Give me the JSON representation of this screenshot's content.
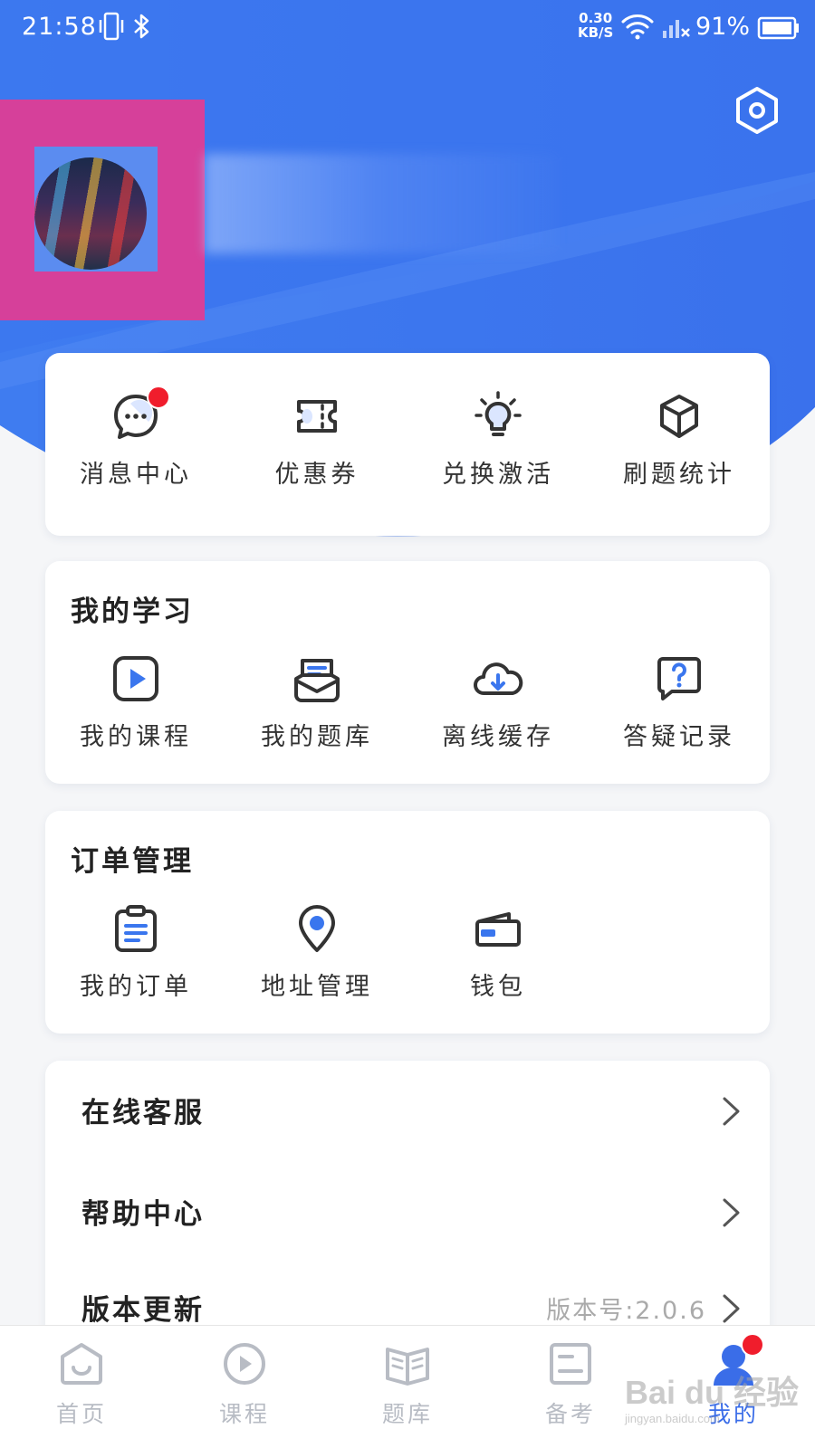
{
  "status_bar": {
    "time": "21:58",
    "net_speed_value": "0.30",
    "net_speed_unit": "KB/S",
    "battery": "91%",
    "icons": [
      "vibrate-icon",
      "bluetooth-icon",
      "wifi-icon",
      "signal-icon",
      "battery-icon"
    ]
  },
  "header": {
    "settings_icon": "settings-hexagon-icon",
    "accent": "#3a76ee"
  },
  "quick_actions": [
    {
      "label": "消息中心",
      "icon": "message-bubble-icon",
      "badge": true
    },
    {
      "label": "优惠券",
      "icon": "ticket-icon",
      "badge": false
    },
    {
      "label": "兑换激活",
      "icon": "lightbulb-icon",
      "badge": false
    },
    {
      "label": "刷题统计",
      "icon": "cube-icon",
      "badge": false
    }
  ],
  "my_study": {
    "title": "我的学习",
    "items": [
      {
        "label": "我的课程",
        "icon": "play-square-icon"
      },
      {
        "label": "我的题库",
        "icon": "tray-icon"
      },
      {
        "label": "离线缓存",
        "icon": "cloud-download-icon"
      },
      {
        "label": "答疑记录",
        "icon": "question-bubble-icon"
      }
    ]
  },
  "orders": {
    "title": "订单管理",
    "items": [
      {
        "label": "我的订单",
        "icon": "clipboard-icon"
      },
      {
        "label": "地址管理",
        "icon": "location-pin-icon"
      },
      {
        "label": "钱包",
        "icon": "wallet-icon"
      }
    ]
  },
  "list": [
    {
      "label": "在线客服",
      "value": ""
    },
    {
      "label": "帮助中心",
      "value": ""
    },
    {
      "label": "版本更新",
      "value": "版本号:2.0.6"
    }
  ],
  "tabbar": [
    {
      "label": "首页",
      "icon": "home-icon",
      "active": false
    },
    {
      "label": "课程",
      "icon": "play-circle-icon",
      "active": false
    },
    {
      "label": "题库",
      "icon": "book-icon",
      "active": false
    },
    {
      "label": "备考",
      "icon": "document-icon",
      "active": false
    },
    {
      "label": "我的",
      "icon": "user-icon",
      "active": true,
      "badge": true
    }
  ],
  "watermark": {
    "main": "Bai du 经验",
    "sub": "jingyan.baidu.com"
  }
}
